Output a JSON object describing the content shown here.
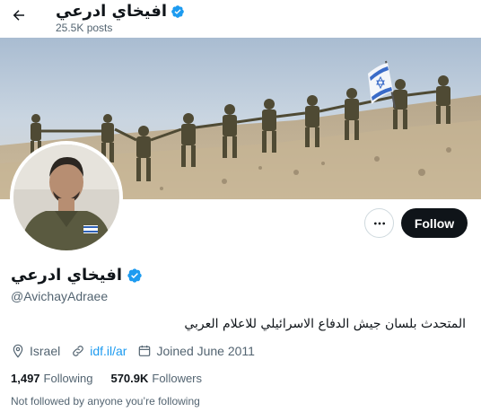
{
  "topbar": {
    "name": "افيخاي ادرعي",
    "posts_count": "25.5K posts"
  },
  "actions": {
    "follow_label": "Follow"
  },
  "profile": {
    "display_name": "افيخاي ادرعي",
    "handle": "@AvichayAdraee",
    "bio": "المتحدث بلسان جيش الدفاع الاسرائيلي للاعلام العربي",
    "location": "Israel",
    "website": "idf.il/ar",
    "joined": "Joined June 2011"
  },
  "stats": {
    "following_count": "1,497",
    "following_label": "Following",
    "followers_count": "570.9K",
    "followers_label": "Followers"
  },
  "followed_by": "Not followed by anyone you’re following",
  "icons": {
    "back": "arrow-left-icon",
    "verified": "verified-badge-icon",
    "more": "more-horizontal-icon",
    "location": "location-pin-icon",
    "link": "link-icon",
    "calendar": "calendar-icon"
  },
  "colors": {
    "accent": "#1d9bf0",
    "text": "#0f1419",
    "muted": "#536471",
    "follow_bg": "#0f1419"
  }
}
